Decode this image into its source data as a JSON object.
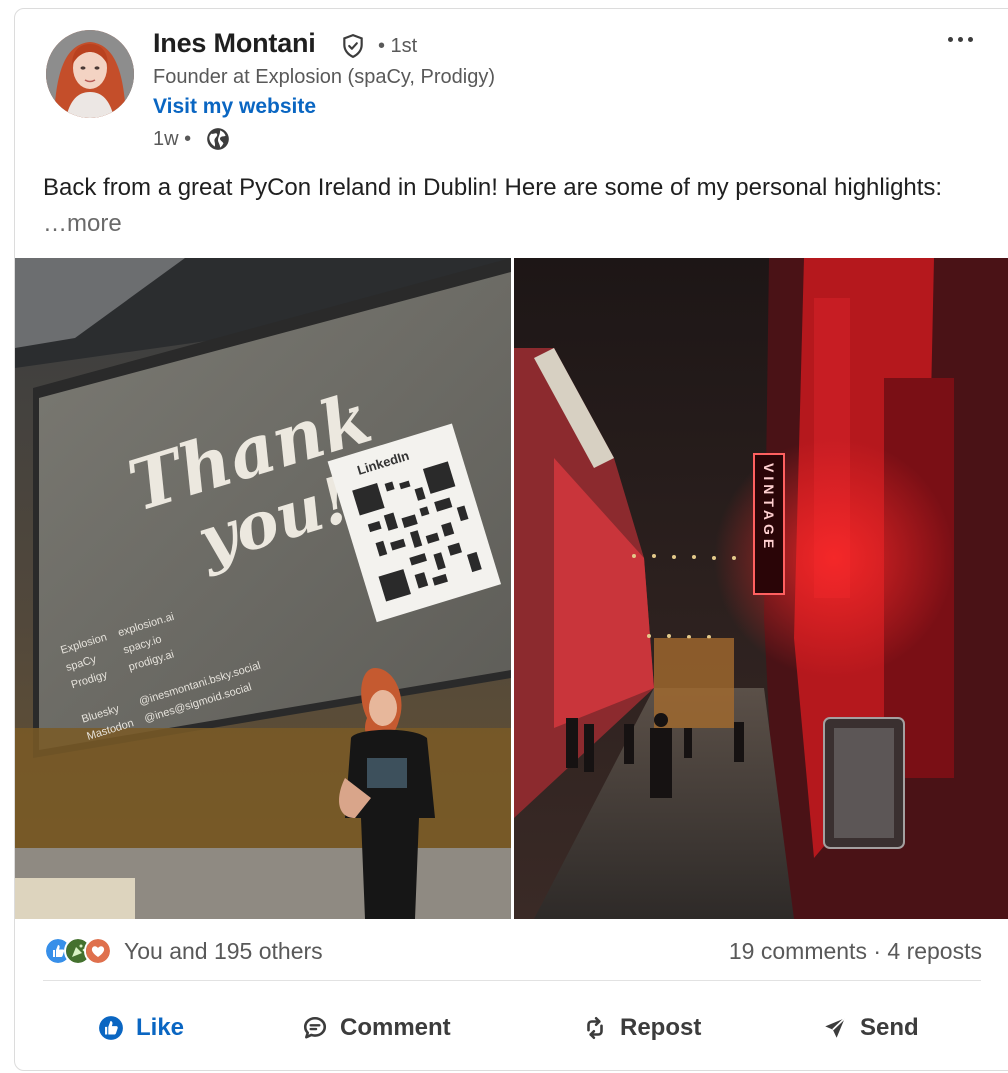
{
  "author": {
    "name": "Ines Montani",
    "degree": "• 1st",
    "headline": "Founder at Explosion (spaCy, Prodigy)",
    "website_label": "Visit my website",
    "timestamp": "1w •"
  },
  "post": {
    "text": "Back from a great PyCon Ireland in Dublin! Here are some of my personal highlights:",
    "see_more": "…more"
  },
  "images": {
    "left": {
      "slide_title_line1": "Thank",
      "slide_title_line2": "you!",
      "qr_label": "LinkedIn",
      "links": [
        {
          "name": "Explosion",
          "value": "explosion.ai"
        },
        {
          "name": "spaCy",
          "value": "spacy.io"
        },
        {
          "name": "Prodigy",
          "value": "prodigy.ai"
        }
      ],
      "socials": [
        {
          "name": "Bluesky",
          "value": "@inesmontani.bsky.social"
        },
        {
          "name": "Mastodon",
          "value": "@ines@sigmoid.social"
        }
      ]
    },
    "right": {
      "sign": "VINTAGE"
    }
  },
  "social": {
    "reactions_summary": "You and 195 others",
    "stats": "19 comments · 4 reposts",
    "reaction_icons": [
      "like-reaction-icon",
      "celebrate-reaction-icon",
      "love-reaction-icon"
    ]
  },
  "actions": {
    "like": "Like",
    "comment": "Comment",
    "repost": "Repost",
    "send": "Send"
  },
  "colors": {
    "brand_blue": "#0a66c2",
    "muted_text": "#595959"
  }
}
